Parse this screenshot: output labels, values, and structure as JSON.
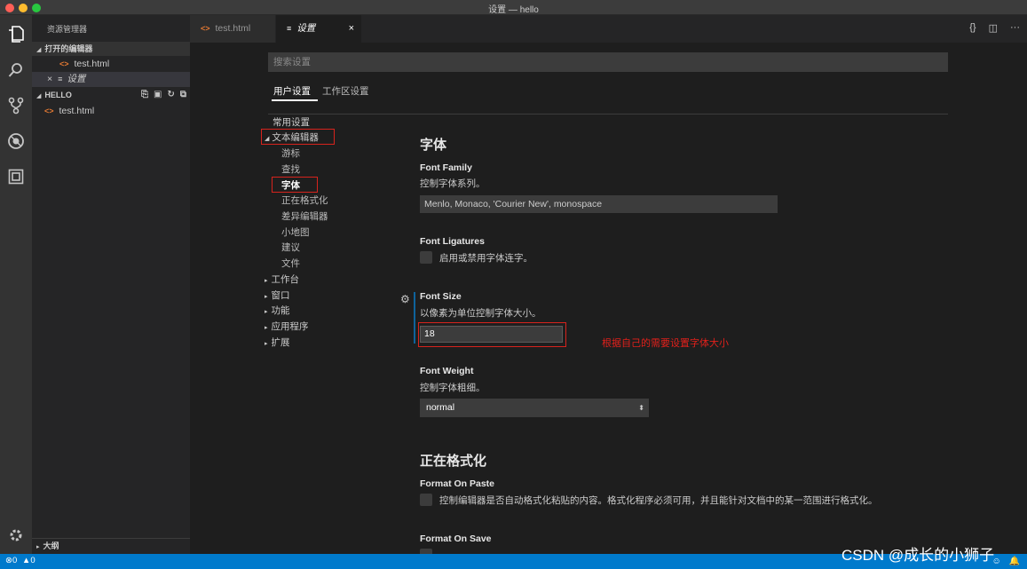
{
  "window": {
    "title": "设置 — hello"
  },
  "sidebar": {
    "title": "资源管理器",
    "open_editors_header": "打开的编辑器",
    "open_editors": [
      {
        "name": "test.html",
        "icon": "html-icon"
      },
      {
        "name": "设置",
        "icon": "settings-file-icon",
        "close": "×"
      }
    ],
    "folder_header": "HELLO",
    "folder_files": [
      {
        "name": "test.html",
        "icon": "html-icon"
      }
    ],
    "outline_header": "大纲"
  },
  "tabs": [
    {
      "label": "test.html",
      "icon": "html-icon"
    },
    {
      "label": "设置",
      "icon": "settings-file-icon",
      "close": "×"
    }
  ],
  "tab_actions": [
    "{}",
    "◫",
    "···"
  ],
  "settings": {
    "search_placeholder": "搜索设置",
    "scope_tabs": {
      "user": "用户设置",
      "workspace": "工作区设置"
    },
    "toc": {
      "common": "常用设置",
      "text_editor": "文本编辑器",
      "text_editor_children": [
        "游标",
        "查找",
        "字体",
        "正在格式化",
        "差异编辑器",
        "小地图",
        "建议",
        "文件"
      ],
      "collapsed": [
        "工作台",
        "窗口",
        "功能",
        "应用程序",
        "扩展"
      ]
    },
    "font_section_title": "字体",
    "font_family": {
      "title": "Font Family",
      "desc": "控制字体系列。",
      "value": "Menlo, Monaco, 'Courier New', monospace"
    },
    "font_ligatures": {
      "title": "Font Ligatures",
      "desc": "启用或禁用字体连字。"
    },
    "font_size": {
      "title": "Font Size",
      "desc": "以像素为单位控制字体大小。",
      "value": "18"
    },
    "annotation": "根据自己的需要设置字体大小",
    "font_weight": {
      "title": "Font Weight",
      "desc": "控制字体粗细。",
      "value": "normal"
    },
    "formatting_section_title": "正在格式化",
    "format_on_paste": {
      "title": "Format On Paste",
      "desc": "控制编辑器是否自动格式化粘贴的内容。格式化程序必须可用，并且能针对文档中的某一范围进行格式化。"
    },
    "format_on_save": {
      "title": "Format On Save"
    }
  },
  "statusbar": {
    "errors": "0",
    "warnings": "0"
  },
  "watermark": "CSDN @成长的小狮子",
  "colors": {
    "accent": "#007acc",
    "highlight_red": "#d7231d"
  }
}
